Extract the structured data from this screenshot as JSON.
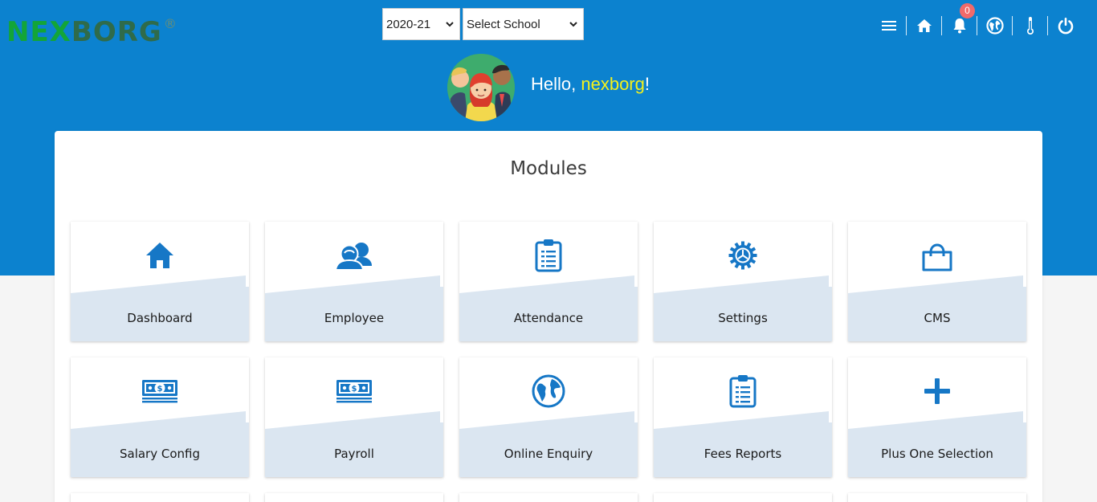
{
  "brand": {
    "logo_text_a": "NEX",
    "logo_text_b": "BORG",
    "logo_mark": "®"
  },
  "filters": {
    "year": {
      "value": "2020-21"
    },
    "school": {
      "value": "Select School"
    }
  },
  "nav": {
    "items": [
      {
        "name": "menu-icon"
      },
      {
        "name": "home-icon"
      },
      {
        "name": "bell-icon",
        "badge": "0"
      },
      {
        "name": "globe-icon"
      },
      {
        "name": "thermometer-icon"
      },
      {
        "name": "power-icon"
      }
    ]
  },
  "greeting": {
    "prefix": "Hello, ",
    "name": "nexborg",
    "suffix": "!"
  },
  "main": {
    "title": "Modules",
    "modules": [
      {
        "label": "Dashboard",
        "icon": "home-icon"
      },
      {
        "label": "Employee",
        "icon": "users-icon"
      },
      {
        "label": "Attendance",
        "icon": "clipboard-icon"
      },
      {
        "label": "Settings",
        "icon": "gear-icon"
      },
      {
        "label": "CMS",
        "icon": "shopping-bag-icon"
      },
      {
        "label": "Salary Config",
        "icon": "money-icon"
      },
      {
        "label": "Payroll",
        "icon": "money-icon"
      },
      {
        "label": "Online Enquiry",
        "icon": "globe-icon"
      },
      {
        "label": "Fees Reports",
        "icon": "clipboard-icon"
      },
      {
        "label": "Plus One Selection",
        "icon": "plus-icon"
      }
    ]
  },
  "colors": {
    "primary": "#0c82cf",
    "accent": "#1677c6",
    "tile_band": "#dbe6f1",
    "name_highlight": "#f4f11b",
    "badge": "#f06a6a"
  }
}
